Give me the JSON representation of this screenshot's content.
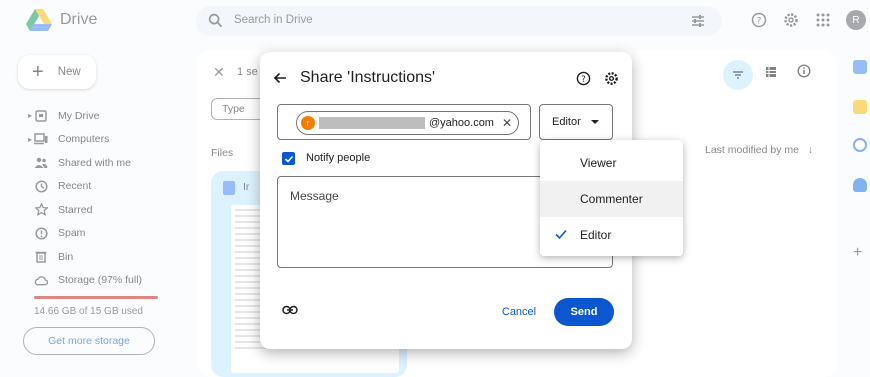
{
  "app": {
    "name": "Drive",
    "avatar_letter": "R"
  },
  "search": {
    "placeholder": "Search in Drive"
  },
  "new_button": {
    "label": "New"
  },
  "sidebar": {
    "items": [
      {
        "label": "My Drive",
        "icon": "my-drive-icon",
        "expandable": true
      },
      {
        "label": "Computers",
        "icon": "computers-icon",
        "expandable": true
      },
      {
        "label": "Shared with me",
        "icon": "shared-icon"
      },
      {
        "label": "Recent",
        "icon": "clock-icon"
      },
      {
        "label": "Starred",
        "icon": "star-icon"
      },
      {
        "label": "Spam",
        "icon": "spam-icon"
      },
      {
        "label": "Bin",
        "icon": "bin-icon"
      },
      {
        "label": "Storage (97% full)",
        "icon": "cloud-icon"
      }
    ],
    "storage_text": "14.66 GB of 15 GB used",
    "storage_fill": 0.97,
    "get_more_storage": "Get more storage"
  },
  "main": {
    "selection_text": "1 se",
    "type_filter": "Type",
    "files_label": "Files",
    "card_name": "Ir",
    "last_modified": "Last modified by me"
  },
  "dialog": {
    "title": "Share 'Instructions'",
    "recipient_initial": "r",
    "recipient_suffix": "@yahoo.com",
    "role": "Editor",
    "notify_label": "Notify people",
    "notify_checked": true,
    "message_placeholder": "Message",
    "cancel": "Cancel",
    "send": "Send"
  },
  "role_menu": {
    "options": [
      "Viewer",
      "Commenter",
      "Editor"
    ],
    "selected": "Editor",
    "hovered": "Commenter"
  },
  "colors": {
    "accent": "#0b57d0",
    "selected_chip": "#c2e7ff",
    "storage_warning": "#c5221f"
  }
}
